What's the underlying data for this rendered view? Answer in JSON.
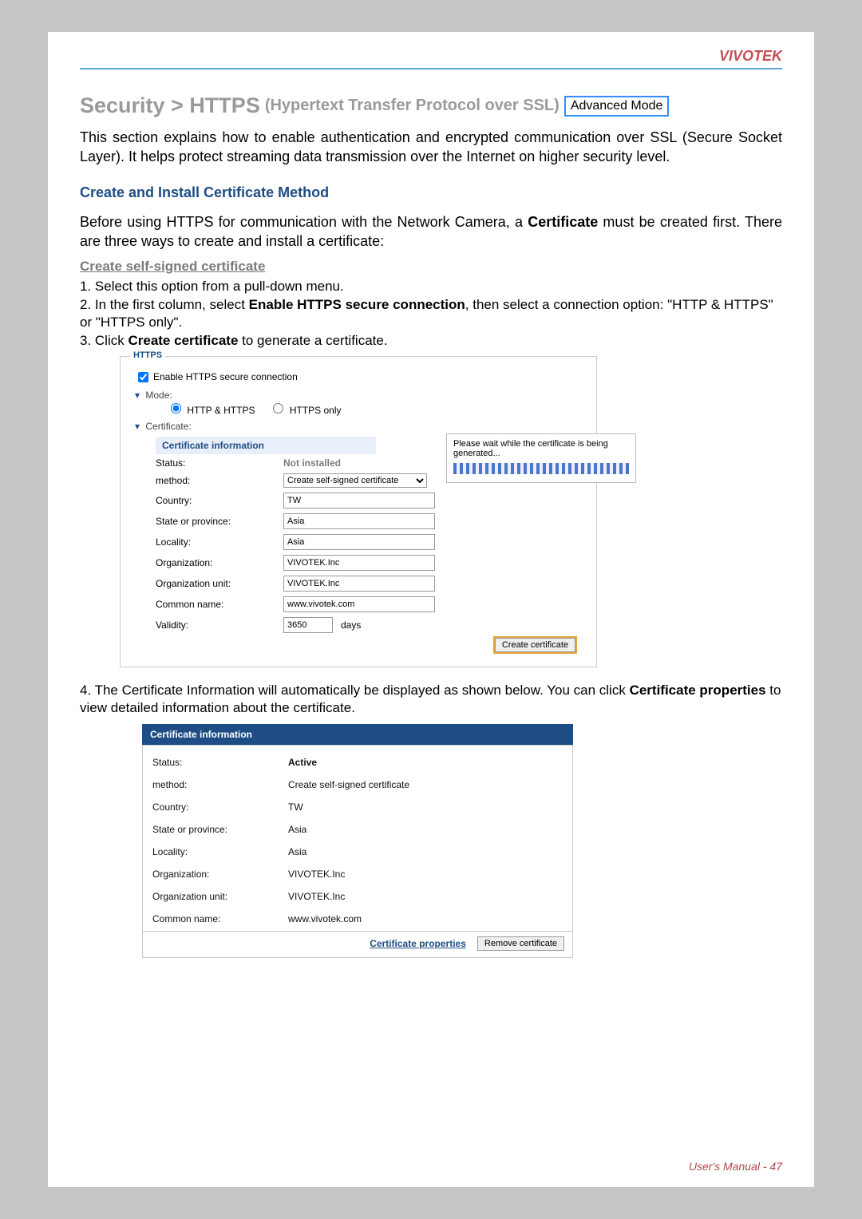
{
  "brand": "VIVOTEK",
  "footer": {
    "label": "User's Manual -",
    "page": "47"
  },
  "heading": {
    "main": "Security >  HTTPS",
    "sub": "(Hypertext Transfer Protocol over SSL)",
    "badge": "Advanced Mode"
  },
  "intro_paragraph": "This section explains how to enable authentication and encrypted communication over SSL (Secure Socket Layer). It helps protect streaming data transmission over the Internet on higher security level.",
  "section_blue": "Create and Install Certificate Method",
  "before_paragraph_1": "Before using HTTPS for communication with the Network Camera, a ",
  "before_paragraph_bold": "Certificate",
  "before_paragraph_2": " must be created first. There are three ways to create and install a certificate:",
  "selfsigned_heading": "Create self-signed certificate",
  "steps": {
    "s1": "1. Select this option from a pull-down menu.",
    "s2a": "2. In the first column, select ",
    "s2b": "Enable HTTPS secure connection",
    "s2c": ", then select a connection option: \"HTTP & HTTPS\" or \"HTTPS only\".",
    "s3a": "3. Click ",
    "s3b": "Create certificate",
    "s3c": " to generate a certificate.",
    "s4a": "4. The Certificate Information will automatically be displayed as shown below. You can click ",
    "s4b": "Certificate properties",
    "s4c": " to view detailed information about the certificate."
  },
  "ui1": {
    "frame_title": "HTTPS",
    "enable_label": "Enable HTTPS secure connection",
    "mode_label": "Mode:",
    "radio_http_https": "HTTP & HTTPS",
    "radio_https_only": "HTTPS only",
    "certificate_label": "Certificate:",
    "cert_info_header": "Certificate information",
    "wait_text": "Please wait while the certificate is being generated...",
    "fields": {
      "status_k": "Status:",
      "status_v": "Not installed",
      "method_k": "method:",
      "method_v": "Create self-signed certificate",
      "country_k": "Country:",
      "country_v": "TW",
      "state_k": "State or province:",
      "state_v": "Asia",
      "locality_k": "Locality:",
      "locality_v": "Asia",
      "org_k": "Organization:",
      "org_v": "VIVOTEK.Inc",
      "orgunit_k": "Organization unit:",
      "orgunit_v": "VIVOTEK.Inc",
      "common_k": "Common name:",
      "common_v": "www.vivotek.com",
      "validity_k": "Validity:",
      "validity_v": "3650",
      "validity_unit": "days"
    },
    "create_btn": "Create certificate"
  },
  "ui2": {
    "title": "Certificate information",
    "rows": {
      "status_k": "Status:",
      "status_v": "Active",
      "method_k": "method:",
      "method_v": "Create self-signed certificate",
      "country_k": "Country:",
      "country_v": "TW",
      "state_k": "State or province:",
      "state_v": "Asia",
      "locality_k": "Locality:",
      "locality_v": "Asia",
      "org_k": "Organization:",
      "org_v": "VIVOTEK.Inc",
      "orgunit_k": "Organization unit:",
      "orgunit_v": "VIVOTEK.Inc",
      "common_k": "Common name:",
      "common_v": "www.vivotek.com"
    },
    "link": "Certificate properties",
    "remove_btn": "Remove certificate"
  }
}
